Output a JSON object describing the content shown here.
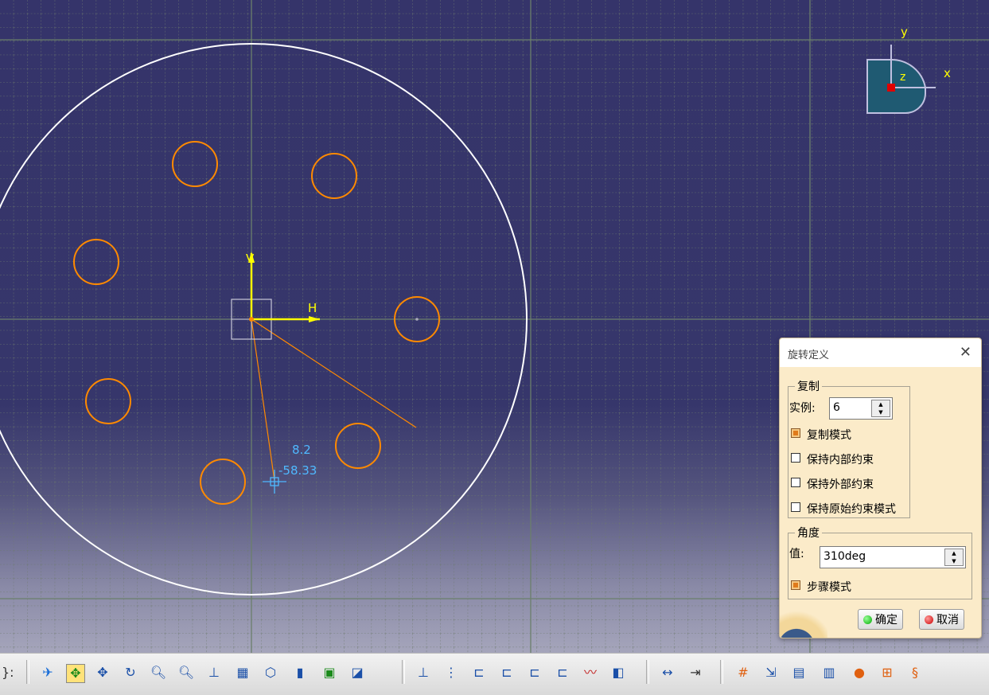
{
  "viewport": {
    "axis_h_label": "H",
    "axis_v_label": "V",
    "cursor_coord_1": "8.2",
    "cursor_coord_2": "-58.33",
    "compass": {
      "x_label": "x",
      "y_label": "y",
      "z_label": "z"
    },
    "colors": {
      "background": "#35346a",
      "circle": "#ffffff",
      "hole": "#ff8a00",
      "axis": "#ffff00",
      "cursor": "#4fb8ff"
    }
  },
  "dialog": {
    "title": "旋转定义",
    "close_icon": "close-icon",
    "copy_group": {
      "legend": "复制",
      "instances_label": "实例:",
      "instances_value": "6",
      "copy_mode_label": "复制模式",
      "copy_mode_checked": true,
      "keep_internal_label": "保持内部约束",
      "keep_external_label": "保持外部约束",
      "keep_original_label": "保持原始约束模式"
    },
    "angle_group": {
      "legend": "角度",
      "value_label": "值:",
      "value": "310deg",
      "step_mode_label": "步骤模式",
      "step_mode_checked": true
    },
    "ok_label": "确定",
    "cancel_label": "取消"
  },
  "toolbar": {
    "left_fragment": "}:"
  }
}
